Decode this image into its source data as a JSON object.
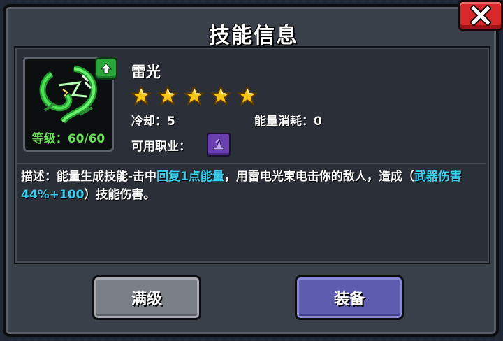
{
  "dialog": {
    "title": "技能信息",
    "close_icon": "close-x-icon"
  },
  "skill": {
    "name": "雷光",
    "icon": "green-lightning-serpent-icon",
    "level_text": "等级：60/60",
    "stars": 5,
    "star_icon": "star-icon",
    "upgrade_badge_icon": "up-arrow-icon",
    "cooldown_label": "冷却：5",
    "energy_cost_label": "能量消耗：0",
    "class_label": "可用职业：",
    "class_icon": "wizard-hat-icon",
    "description": {
      "part1": "描述：能量生成技能-击中",
      "highlight1": "回复1点能量",
      "part2": "，用雷电光束电击你的敌人，造成（",
      "highlight2": "武器伤害44%+100",
      "part3": "）技能伤害。"
    }
  },
  "buttons": {
    "max_level": "满级",
    "equip": "装备"
  },
  "colors": {
    "highlight": "#3ad0f0",
    "level": "#69e05a",
    "star": "#f5c518",
    "close_red": "#d8282a",
    "equip_purple": "#5d5cae"
  }
}
